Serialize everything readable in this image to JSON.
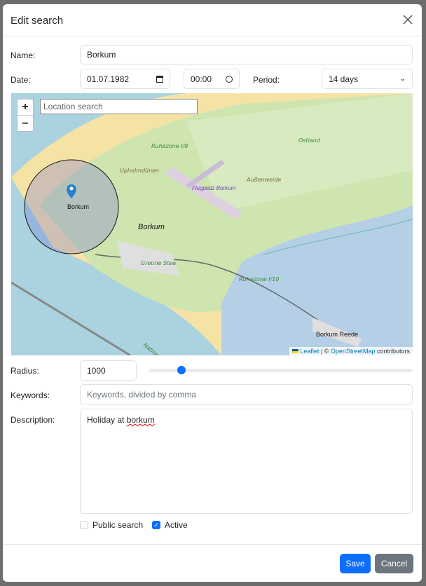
{
  "modal": {
    "title": "Edit search"
  },
  "form": {
    "name_label": "Name:",
    "name_value": "Borkum",
    "date_label": "Date:",
    "date_value": "01.07.1982",
    "time_value": "00:00",
    "period_label": "Period:",
    "period_value": "14 days",
    "radius_label": "Radius:",
    "radius_value": "1000",
    "radius_slider_fraction": 0.11,
    "keywords_label": "Keywords:",
    "keywords_placeholder": "Keywords, divided by comma",
    "description_label": "Description:",
    "description_prefix": "Holiday at ",
    "description_word": "borkum",
    "public_label": "Public search",
    "public_checked": false,
    "active_label": "Active",
    "active_checked": true
  },
  "map": {
    "zoom_in": "+",
    "zoom_out": "−",
    "search_placeholder": "Location search",
    "labels": {
      "ruhezone8": "Ruhezone I/8",
      "upholm": "Upholmdünen",
      "airport": "Flugplatz Borkum",
      "aussenweide": "Außenweide",
      "ostland": "Ostland",
      "town": "Borkum",
      "marker": "Borkum",
      "greune": "Greune Stee",
      "ruhezone10": "Ruhezone I/10",
      "reede": "Borkum Reede",
      "national": "Nationalpark"
    },
    "attribution": {
      "leaflet": "Leaflet",
      "sep": " | © ",
      "osm": "OpenStreetMap",
      "contrib": " contributors"
    }
  },
  "footer": {
    "save": "Save",
    "cancel": "Cancel"
  },
  "colors": {
    "primary": "#0d6efd",
    "secondary": "#6c757d"
  }
}
